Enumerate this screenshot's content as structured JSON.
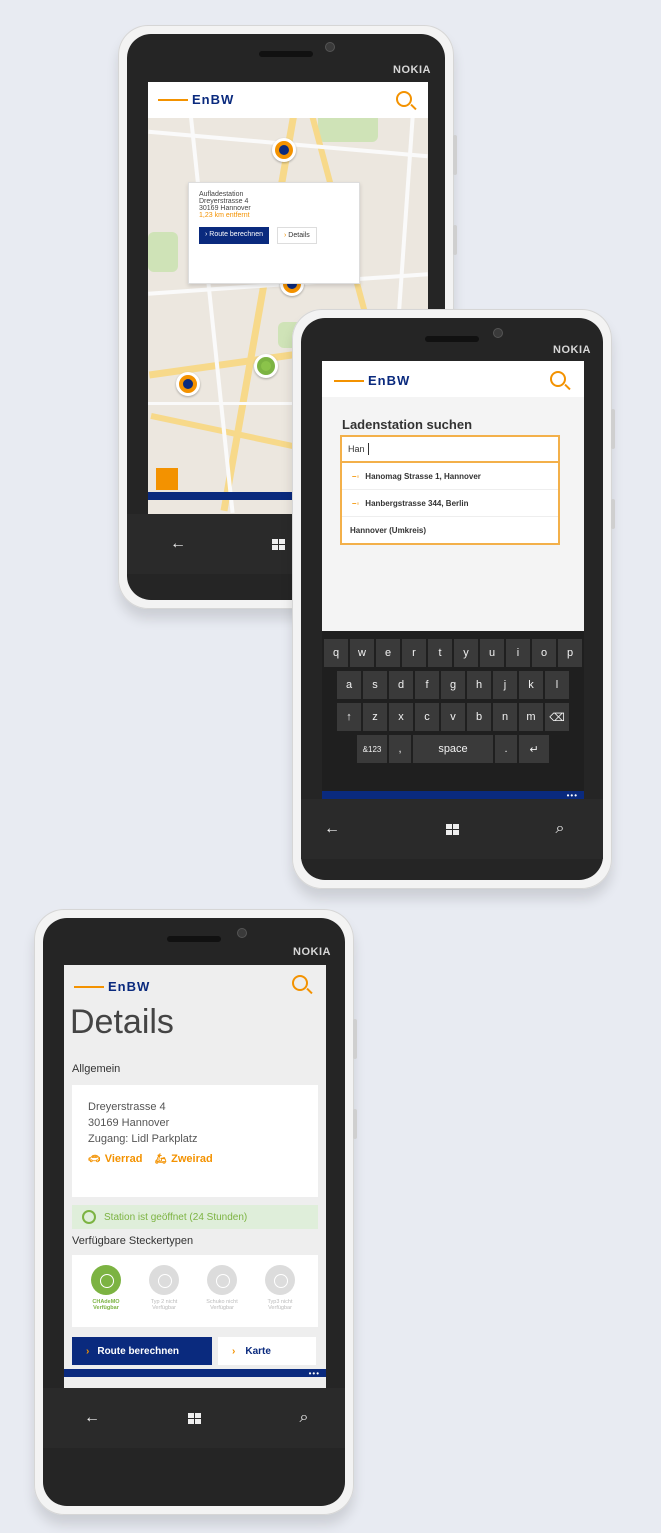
{
  "phones": {
    "brand": "NOKIA",
    "logo_text": "EnBW"
  },
  "map_phone": {
    "popup": {
      "title": "Aufladestation",
      "street": "Dreyerstrasse 4",
      "city": "30169 Hannover",
      "distance": "1,23 km entfernt",
      "route_button": "Route berechnen",
      "details_button": "Details"
    }
  },
  "search_phone": {
    "title": "Ladenstation suchen",
    "input_value": "Han",
    "suggestions": [
      {
        "label": "Hanomag Strasse 1, Hannover",
        "pin": true
      },
      {
        "label": "Hanbergstrasse 344, Berlin",
        "pin": true
      },
      {
        "label": "Hannover (Umkreis)",
        "pin": false
      }
    ],
    "keyboard": {
      "row1": [
        "q",
        "w",
        "e",
        "r",
        "t",
        "y",
        "u",
        "i",
        "o",
        "p"
      ],
      "row2": [
        "a",
        "s",
        "d",
        "f",
        "g",
        "h",
        "j",
        "k",
        "l"
      ],
      "row3": [
        "↑",
        "z",
        "x",
        "c",
        "v",
        "b",
        "n",
        "m",
        "⌫"
      ],
      "row4": [
        "&123",
        ",",
        "space",
        ".",
        "↵"
      ]
    },
    "more_dots": "•••"
  },
  "details_phone": {
    "title": "Details",
    "section_general": "Allgemein",
    "address_line1": "Dreyerstrasse 4",
    "address_line2": "30169 Hannover",
    "address_line3": "Zugang: Lidl Parkplatz",
    "vehicle_car": "Vierrad",
    "vehicle_bike": "Zweirad",
    "open_status": "Station ist geöffnet (24 Stunden)",
    "section_plugs": "Verfügbare Steckertypen",
    "plugs": [
      {
        "line1": "CHAdeMO",
        "line2": "Verfügbar",
        "active": true
      },
      {
        "line1": "Typ 2 nicht",
        "line2": "Verfügbar",
        "active": false
      },
      {
        "line1": "Schuko nicht",
        "line2": "Verfügbar",
        "active": false
      },
      {
        "line1": "Typ3 nicht",
        "line2": "Verfügbar",
        "active": false
      }
    ],
    "route_button": "Route berechnen",
    "map_button": "Karte",
    "more_dots": "•••"
  },
  "navbar": {
    "back": "←",
    "search": "⌕"
  },
  "colors": {
    "accent_orange": "#f39200",
    "brand_blue": "#0a2a7e",
    "status_green": "#7cb342"
  }
}
